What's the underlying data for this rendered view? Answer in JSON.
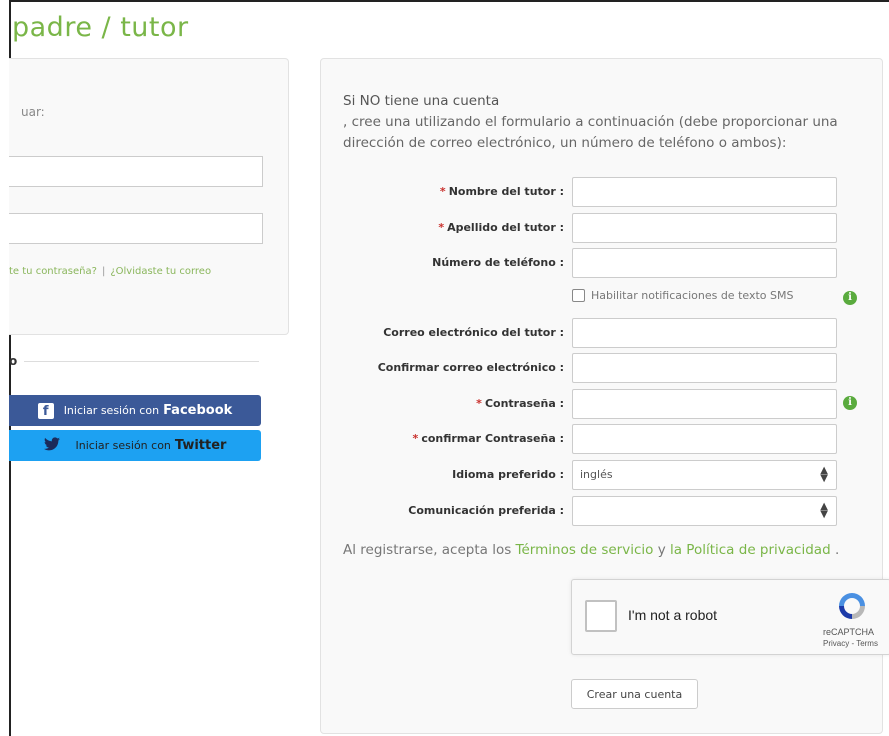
{
  "page": {
    "title": "padre / tutor"
  },
  "login": {
    "prompt": "uar:",
    "forgot_password": "te tu contraseña?",
    "separator": "|",
    "forgot_email": "¿Olvidaste tu correo",
    "divider_text": "o",
    "facebook_prefix": "Iniciar sesión con",
    "facebook_brand": "Facebook",
    "twitter_prefix": "Iniciar sesión con",
    "twitter_brand": "Twitter"
  },
  "register": {
    "intro_line1": "Si NO tiene una cuenta",
    "intro_line2": ", cree una utilizando el formulario a continuación (debe proporcionar una dirección de correo electrónico, un número de teléfono o ambos):",
    "required_marker": "*",
    "fields": {
      "first_name": "Nombre del tutor :",
      "last_name": "Apellido del tutor :",
      "phone": "Número de teléfono :",
      "email": "Correo electrónico del tutor :",
      "confirm_email": "Confirmar correo electrónico :",
      "password": "Contraseña :",
      "confirm_password": "confirmar Contraseña :",
      "language": "Idioma preferido :",
      "communication": "Comunicación preferida :"
    },
    "sms_label": "Habilitar notificaciones de texto SMS",
    "language_value": "inglés",
    "communication_value": "",
    "terms_prefix": "Al registrarse, acepta los",
    "terms_link": "Términos de servicio",
    "terms_and": "y",
    "privacy_link": "la Política de privacidad",
    "terms_suffix": ".",
    "create_button": "Crear una cuenta"
  },
  "recaptcha": {
    "label": "I'm not a robot",
    "brand": "reCAPTCHA",
    "legal": "Privacy - Terms"
  },
  "icons": {
    "info": "info-icon",
    "checkbox": "checkbox-icon",
    "facebook": "facebook-icon",
    "twitter": "twitter-icon",
    "recaptcha": "recaptcha-logo-icon",
    "select": "select-arrows-icon"
  },
  "colors": {
    "accent": "#7ab648",
    "facebook": "#3b5998",
    "twitter": "#1da1f2",
    "required": "#c9302c",
    "info": "#5aab3e"
  }
}
